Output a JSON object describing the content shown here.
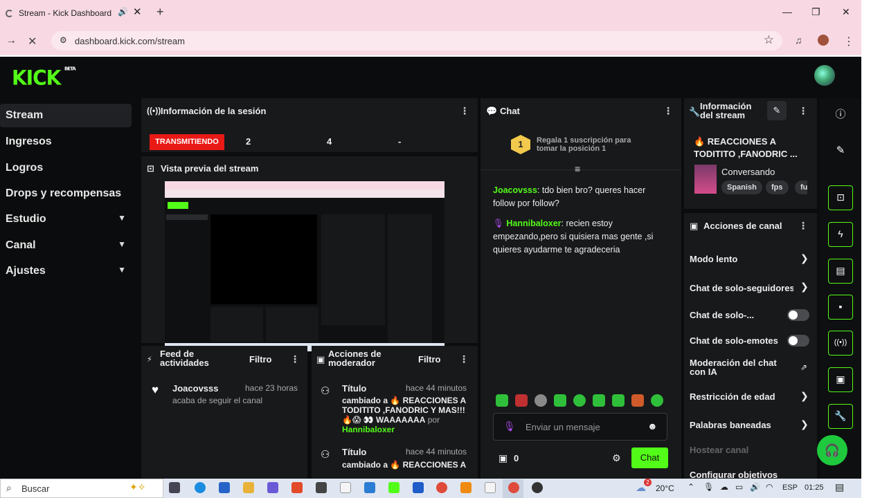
{
  "browser": {
    "tab_title": "Stream - Kick Dashboard",
    "url": "dashboard.kick.com/stream"
  },
  "logo": "KICK",
  "logo_badge": "BETA",
  "sidebar": {
    "items": [
      {
        "label": "Stream"
      },
      {
        "label": "Ingresos"
      },
      {
        "label": "Logros"
      },
      {
        "label": "Drops y recompensas"
      },
      {
        "label": "Estudio"
      },
      {
        "label": "Canal"
      },
      {
        "label": "Ajustes"
      }
    ]
  },
  "session": {
    "title": "Información de la sesión",
    "status": "TRANSMITIENDO",
    "stat1": "2",
    "stat2": "4",
    "stat3": "-"
  },
  "preview": {
    "title": "Vista previa del stream"
  },
  "feed": {
    "title": "Feed de actividades",
    "filter": "Filtro",
    "user": "Joacovsss",
    "time": "hace 23 horas",
    "text": "acaba de seguir el canal"
  },
  "modactions": {
    "title": "Acciones de moderador",
    "filter": "Filtro",
    "items": [
      {
        "label": "Título",
        "time": "hace 44 minutos",
        "text": "cambiado a 🔥 REACCIONES A TODITITO ,FANODRIC Y MAS!!!🔥😱 👀 WAAAAAAA",
        "by": "por",
        "user": "Hannibaloxer"
      },
      {
        "label": "Título",
        "time": "hace 44 minutos",
        "text": "cambiado a 🔥 REACCIONES A"
      }
    ]
  },
  "chat": {
    "title": "Chat",
    "gift_rank": "1",
    "gift_text": "Regala 1 suscripción para tomar la posición 1",
    "messages": [
      {
        "user": "Joacovsss",
        "text": ": tdo bien bro? queres hacer follow por follow?"
      },
      {
        "user": "Hannibaloxer",
        "text": ": recien estoy empezando,pero si quisiera mas gente ,si quieres ayudarme te agradeceria"
      }
    ],
    "placeholder": "Enviar un mensaje",
    "count": "0",
    "send": "Chat"
  },
  "stream_info": {
    "title": "Información del stream",
    "stream_title": "🔥 REACCIONES A TODITITO ,FANODRIC ...",
    "category": "Conversando",
    "tags": [
      "Spanish",
      "fps",
      "fu"
    ]
  },
  "channel_actions": {
    "title": "Acciones de canal",
    "items": [
      {
        "label": "Modo lento"
      },
      {
        "label": "Chat de solo-seguidores"
      },
      {
        "label": "Chat de solo-..."
      },
      {
        "label": "Chat de solo-emotes"
      },
      {
        "label": "Moderación del chat con IA"
      },
      {
        "label": "Restricción de edad"
      },
      {
        "label": "Palabras baneadas"
      },
      {
        "label": "Hostear canal"
      },
      {
        "label": "Configurar objetivos"
      }
    ]
  },
  "taskbar": {
    "search": "Buscar",
    "temp": "20°C",
    "lang": "ESP",
    "time": "01:25",
    "weather_badge": "2"
  },
  "colors": {
    "accent": "#53fc18",
    "live": "#e91916"
  }
}
